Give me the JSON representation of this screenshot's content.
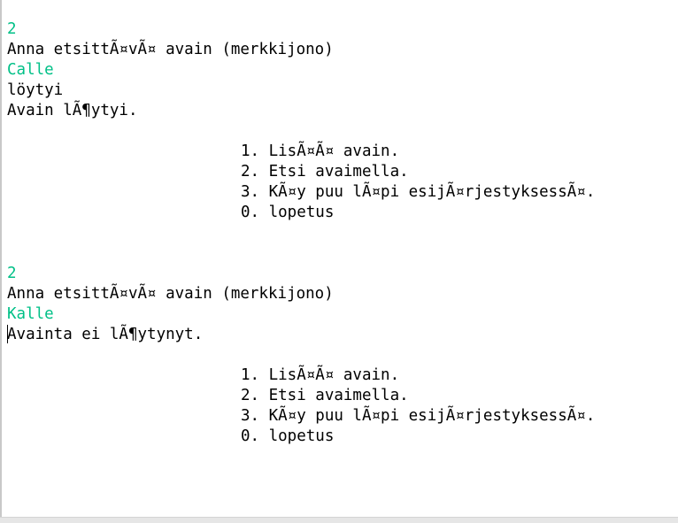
{
  "console": {
    "session1": {
      "menu_choice": "2",
      "prompt": "Anna etsittÃ¤vÃ¤ avain (merkkijono)",
      "key_input": "Calle",
      "found_line": "löytyi",
      "result": "Avain lÃ¶ytyi."
    },
    "menu1": [
      "1. LisÃ¤Ã¤ avain.",
      "2. Etsi avaimella.",
      "3. KÃ¤y puu lÃ¤pi esijÃ¤rjestyksessÃ¤.",
      "0. lopetus"
    ],
    "session2": {
      "menu_choice": "2",
      "prompt": "Anna etsittÃ¤vÃ¤ avain (merkkijono)",
      "key_input": "Kalle",
      "result": "Avainta ei lÃ¶ytynyt."
    },
    "menu2": [
      "1. LisÃ¤Ã¤ avain.",
      "2. Etsi avaimella.",
      "3. KÃ¤y puu lÃ¤pi esijÃ¤rjestyksessÃ¤.",
      "0. lopetus"
    ]
  },
  "colors": {
    "background": "#ffffff",
    "output_text": "#000000",
    "user_input_text": "#00c087"
  }
}
